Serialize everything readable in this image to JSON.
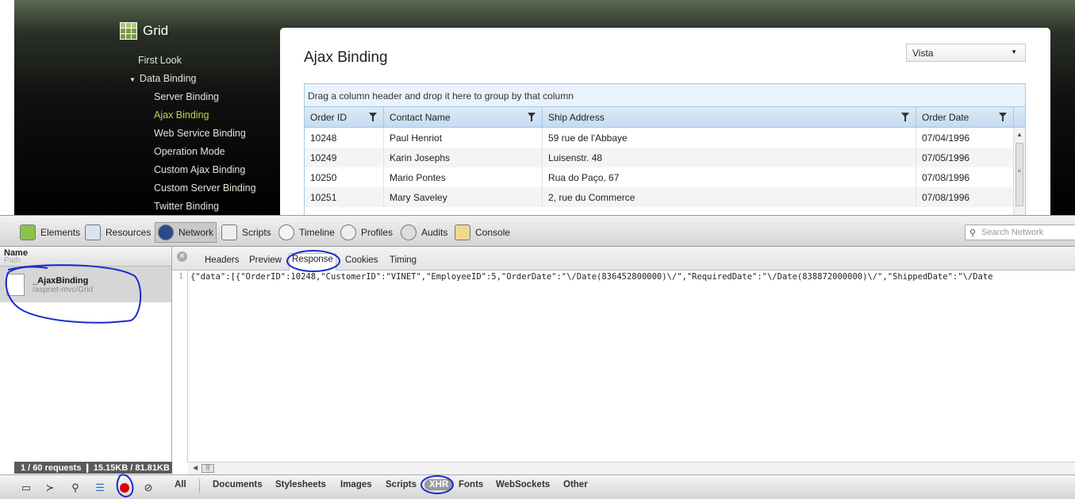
{
  "site": {
    "logo_text": "Grid",
    "nav": {
      "first_look": "First Look",
      "data_binding": "Data Binding",
      "server_binding": "Server Binding",
      "ajax_binding": "Ajax Binding",
      "web_service_binding": "Web Service Binding",
      "operation_mode": "Operation Mode",
      "custom_ajax_binding": "Custom Ajax Binding",
      "custom_server_binding": "Custom Server Binding",
      "twitter_binding": "Twitter Binding"
    },
    "page_title": "Ajax Binding",
    "theme_select": "Vista",
    "grid": {
      "group_hint": "Drag a column header and drop it here to group by that column",
      "columns": [
        "Order ID",
        "Contact Name",
        "Ship Address",
        "Order Date"
      ],
      "rows": [
        [
          "10248",
          "Paul Henriot",
          "59 rue de l'Abbaye",
          "07/04/1996"
        ],
        [
          "10249",
          "Karin Josephs",
          "Luisenstr. 48",
          "07/05/1996"
        ],
        [
          "10250",
          "Mario Pontes",
          "Rua do Paço, 67",
          "07/08/1996"
        ],
        [
          "10251",
          "Mary Saveley",
          "2, rue du Commerce",
          "07/08/1996"
        ]
      ]
    }
  },
  "devtools": {
    "panels": {
      "elements": "Elements",
      "resources": "Resources",
      "network": "Network",
      "scripts": "Scripts",
      "timeline": "Timeline",
      "profiles": "Profiles",
      "audits": "Audits",
      "console": "Console"
    },
    "search_placeholder": "Search Network",
    "list_header": {
      "name": "Name",
      "path": "Path"
    },
    "request": {
      "name": "_AjaxBinding",
      "path": "/aspnet-mvc/Grid"
    },
    "status": "1 / 60 requests  ❙  15.15KB / 81.81KB",
    "tabs": {
      "headers": "Headers",
      "preview": "Preview",
      "response": "Response",
      "cookies": "Cookies",
      "timing": "Timing"
    },
    "line_number": "1",
    "response_text": "{\"data\":[{\"OrderID\":10248,\"CustomerID\":\"VINET\",\"EmployeeID\":5,\"OrderDate\":\"\\/Date(836452800000)\\/\",\"RequiredDate\":\"\\/Date(838872000000)\\/\",\"ShippedDate\":\"\\/Date",
    "filters": {
      "all": "All",
      "documents": "Documents",
      "stylesheets": "Stylesheets",
      "images": "Images",
      "scripts": "Scripts",
      "xhr": "XHR",
      "fonts": "Fonts",
      "websockets": "WebSockets",
      "other": "Other"
    }
  },
  "colors": {
    "nav_highlight": "#b6d94c",
    "annotation": "#1a2ccc",
    "record": "#dd0000"
  }
}
